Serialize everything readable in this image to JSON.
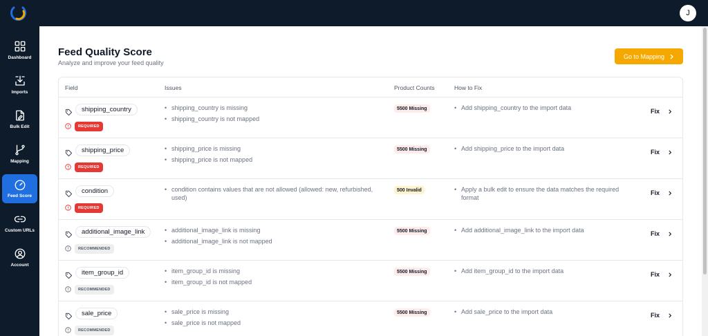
{
  "user": {
    "avatar_initial": "J"
  },
  "sidebar": {
    "items": [
      {
        "label": "Dashboard",
        "icon": "dashboard-icon",
        "active": false
      },
      {
        "label": "Imports",
        "icon": "import-icon",
        "active": false
      },
      {
        "label": "Bulk Edit",
        "icon": "edit-file-icon",
        "active": false
      },
      {
        "label": "Mapping",
        "icon": "git-branch-icon",
        "active": false
      },
      {
        "label": "Feed Score",
        "icon": "gauge-icon",
        "active": true
      },
      {
        "label": "Custom URLs",
        "icon": "link-icon",
        "active": false
      },
      {
        "label": "Account",
        "icon": "user-circle-icon",
        "active": false
      }
    ]
  },
  "header": {
    "title": "Feed Quality Score",
    "subtitle": "Analyze and improve your feed quality",
    "mapping_button": "Go to Mapping"
  },
  "table": {
    "columns": [
      "Field",
      "Issues",
      "Product Counts",
      "How to Fix"
    ],
    "rows": [
      {
        "field": "shipping_country",
        "priority": "REQUIRED",
        "issues": [
          "shipping_country is missing",
          "shipping_country is not mapped"
        ],
        "count": "5500 Missing",
        "fix": "Add shipping_country to the import data",
        "action": "Fix"
      },
      {
        "field": "shipping_price",
        "priority": "REQUIRED",
        "issues": [
          "shipping_price is missing",
          "shipping_price is not mapped"
        ],
        "count": "5500 Missing",
        "fix": "Add shipping_price to the import data",
        "action": "Fix"
      },
      {
        "field": "condition",
        "priority": "REQUIRED",
        "issues": [
          "condition contains values that are not allowed (allowed: new, refurbished, used)"
        ],
        "count": "500 Invalid",
        "fix": "Apply a bulk edit to ensure the data matches the required format",
        "action": "Fix"
      },
      {
        "field": "additional_image_link",
        "priority": "RECOMMENDED",
        "issues": [
          "additional_image_link is missing",
          "additional_image_link is not mapped"
        ],
        "count": "5500 Missing",
        "fix": "Add additional_image_link to the import data",
        "action": "Fix"
      },
      {
        "field": "item_group_id",
        "priority": "RECOMMENDED",
        "issues": [
          "item_group_id is missing",
          "item_group_id is not mapped"
        ],
        "count": "5500 Missing",
        "fix": "Add item_group_id to the import data",
        "action": "Fix"
      },
      {
        "field": "sale_price",
        "priority": "RECOMMENDED",
        "issues": [
          "sale_price is missing",
          "sale_price is not mapped"
        ],
        "count": "5500 Missing",
        "fix": "Add sale_price to the import data",
        "action": "Fix"
      }
    ]
  },
  "colors": {
    "sidebar_bg": "#0d1b2a",
    "active_nav": "#1f6fe0",
    "accent_button": "#f5a800",
    "required_badge": "#e53935"
  }
}
